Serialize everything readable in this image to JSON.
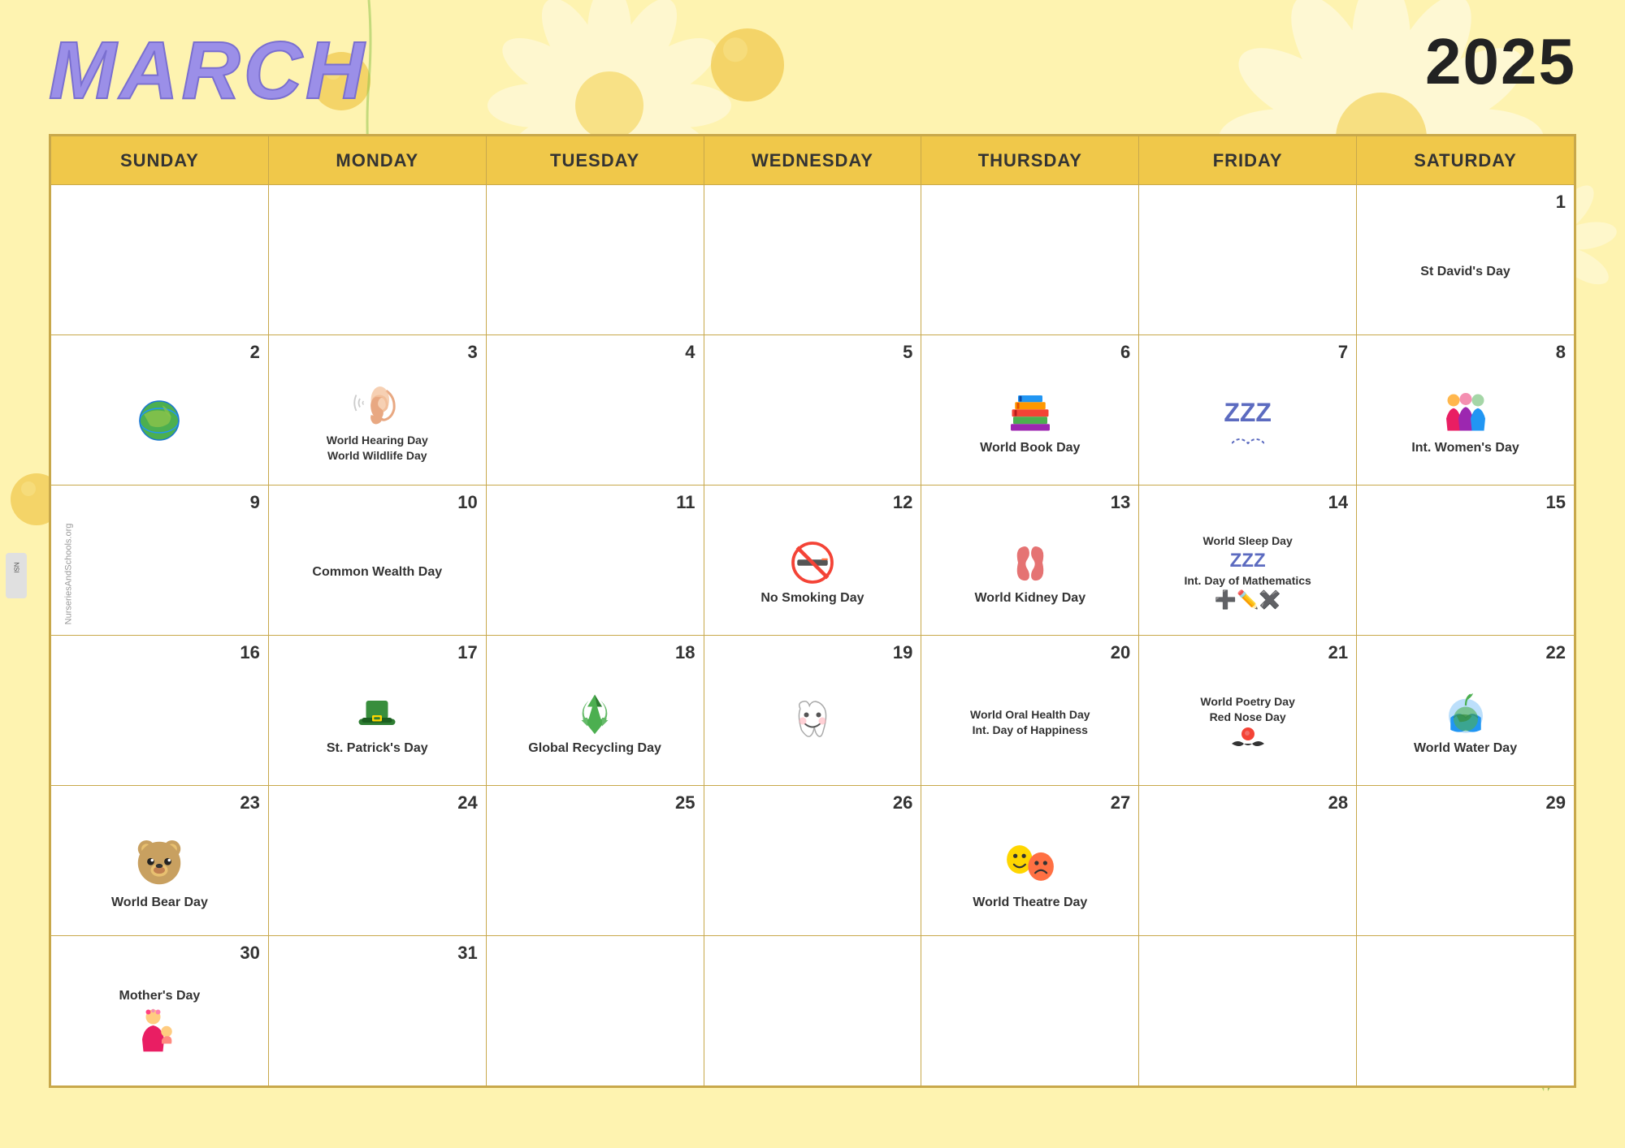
{
  "header": {
    "month": "MARCH",
    "year": "2025"
  },
  "days_of_week": [
    "SUNDAY",
    "MONDAY",
    "TUESDAY",
    "WEDNESDAY",
    "THURSDAY",
    "FRIDAY",
    "SATURDAY"
  ],
  "weeks": [
    [
      {
        "date": "",
        "events": []
      },
      {
        "date": "",
        "events": [],
        "icon": "ear"
      },
      {
        "date": "",
        "events": []
      },
      {
        "date": "",
        "events": []
      },
      {
        "date": "",
        "events": []
      },
      {
        "date": "",
        "events": []
      },
      {
        "date": "1",
        "events": [
          "St David's Day"
        ]
      }
    ],
    [
      {
        "date": "2",
        "events": [],
        "icon": "earth"
      },
      {
        "date": "3",
        "events": [
          "World Hearing Day",
          "World Wildlife Day"
        ],
        "icon": "ear"
      },
      {
        "date": "4",
        "events": []
      },
      {
        "date": "5",
        "events": []
      },
      {
        "date": "6",
        "events": [
          "World Book Day"
        ],
        "icon": "books"
      },
      {
        "date": "7",
        "events": [],
        "icon": "zzz"
      },
      {
        "date": "8",
        "events": [
          "Int. Women's Day"
        ],
        "icon": "women"
      }
    ],
    [
      {
        "date": "9",
        "events": []
      },
      {
        "date": "10",
        "events": [
          "Common Wealth Day"
        ]
      },
      {
        "date": "11",
        "events": []
      },
      {
        "date": "12",
        "events": [
          "No Smoking Day"
        ],
        "icon": "nosmoking"
      },
      {
        "date": "13",
        "events": [
          "World Kidney Day"
        ],
        "icon": "kidney"
      },
      {
        "date": "14",
        "events": [
          "World Sleep Day",
          "Int. Day of Mathematics"
        ],
        "icon": "zzz2"
      },
      {
        "date": "15",
        "events": [],
        "icon": "math"
      }
    ],
    [
      {
        "date": "16",
        "events": []
      },
      {
        "date": "17",
        "events": [
          "St. Patrick's Day"
        ],
        "icon": "hat"
      },
      {
        "date": "18",
        "events": [
          "Global Recycling Day"
        ],
        "icon": "recycle"
      },
      {
        "date": "19",
        "events": [],
        "icon": "tooth"
      },
      {
        "date": "20",
        "events": [
          "World Oral Health Day",
          "Int. Day of Happiness"
        ],
        "icon": "tooth2"
      },
      {
        "date": "21",
        "events": [
          "World Poetry Day",
          "Red Nose Day"
        ],
        "icon": "rednose"
      },
      {
        "date": "22",
        "events": [
          "World Water Day"
        ],
        "icon": "water"
      }
    ],
    [
      {
        "date": "23",
        "events": [
          "World Bear Day"
        ],
        "icon": "bear"
      },
      {
        "date": "24",
        "events": []
      },
      {
        "date": "25",
        "events": []
      },
      {
        "date": "26",
        "events": []
      },
      {
        "date": "27",
        "events": [
          "World Theatre Day"
        ],
        "icon": "theatre"
      },
      {
        "date": "28",
        "events": []
      },
      {
        "date": "29",
        "events": []
      }
    ],
    [
      {
        "date": "30",
        "events": [
          "Mother's Day"
        ],
        "icon": "mother"
      },
      {
        "date": "31",
        "events": []
      },
      {
        "date": "",
        "events": []
      },
      {
        "date": "",
        "events": []
      },
      {
        "date": "",
        "events": []
      },
      {
        "date": "",
        "events": []
      },
      {
        "date": "",
        "events": []
      }
    ]
  ],
  "colors": {
    "header_bg": "#f0c84a",
    "bg": "#fef3b0",
    "border": "#c8a84b",
    "month_color": "#9b8fe8",
    "text_dark": "#333333"
  }
}
